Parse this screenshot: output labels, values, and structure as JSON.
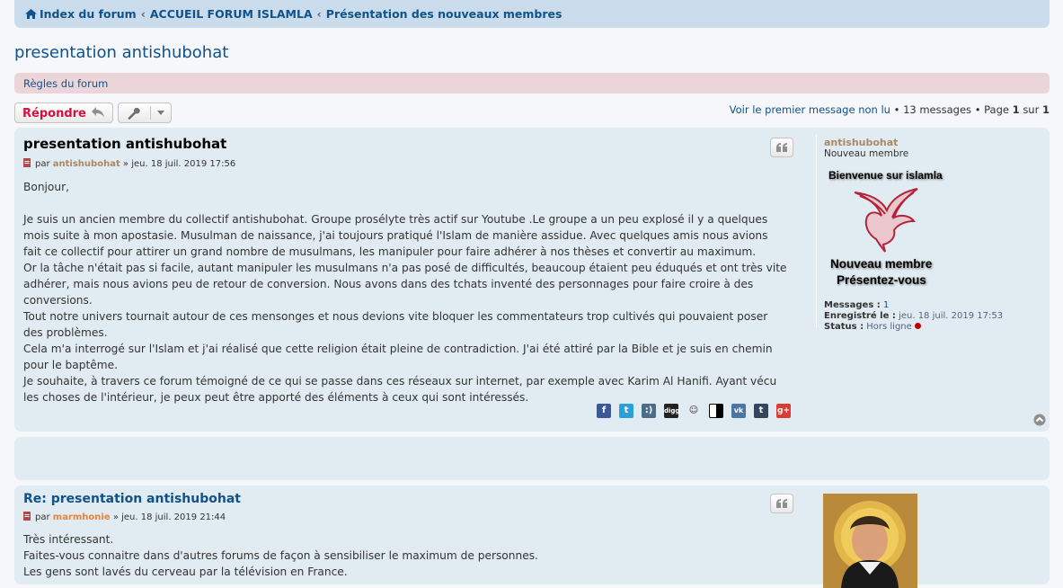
{
  "breadcrumb": {
    "home": "Index du forum",
    "items": [
      "ACCUEIL FORUM ISLAMLA",
      "Présentation des nouveaux membres"
    ],
    "separator": "‹"
  },
  "topic": {
    "title": "presentation antishubohat"
  },
  "rules": {
    "label": "Règles du forum"
  },
  "actions": {
    "reply_label": "Répondre",
    "reply_icon": "reply-icon",
    "tools_icon": "wrench-icon"
  },
  "pagination": {
    "first_unread": "Voir le premier message non lu",
    "bullet": "•",
    "messages": "13 messages",
    "page_label": "Page",
    "current": "1",
    "of": "sur",
    "total": "1"
  },
  "posts": [
    {
      "title": "presentation antishubohat",
      "by": "par",
      "author": "antishubohat",
      "sep": "»",
      "date": "jeu. 18 juil. 2019 17:56",
      "paragraphs": [
        "Bonjour,",
        "",
        "Je suis un ancien membre du collectif antishubohat. Groupe prosélyte très actif sur Youtube .Le groupe a un peu explosé il y a quelques mois suite à mon apostasie. Musulman de naissance, j'ai toujours pratiqué l'Islam de manière assidue. Avec quelques amis nous avions fait ce collectif pour attirer un grand nombre de musulmans, les manipuler pour faire adhérer à nos thèses et convertir au maximum.",
        "Or la tâche n'était pas si facile, autant manipuler les musulmans n'a pas posé de difficultés, beaucoup étaient peu éduqués et ont très vite adhérer, mais nous avions peu de retour de conversion. Nous avons dans des tchats inventé des personnages pour faire croire à des conversions.",
        "Tout notre univers tournait autour de ces mensonges et nous devions vite bloquer les commentateurs trop cultivés qui pouvaient poser des problèmes.",
        "Cela m'a interrogé sur l'Islam et j'ai réalisé que cette religion était pleine de contradiction. J'ai été attiré par la Bible et je suis en chemin pour le baptême.",
        "Je souhaite, à travers ce forum témoigné de ce qui se passe dans ces réseaux sur internet, par exemple avec Karim Al Hanifi. Ayant vécu les choses de l'intérieur, je peux peut être apporté des éléments à ceux qui sont intéressés."
      ],
      "profile": {
        "name": "antishubohat",
        "rank": "Nouveau membre",
        "rank_image_line1": "Bienvenue sur islamla",
        "rank_image_line2": "Nouveau membre",
        "rank_image_line3": "Présentez-vous",
        "messages_label": "Messages :",
        "messages_value": "1",
        "registered_label": "Enregistré le :",
        "registered_value": "jeu. 18 juil. 2019 17:53",
        "status_label": "Status :",
        "status_value": "Hors ligne"
      },
      "share_icons": [
        "facebook-icon",
        "twitter-icon",
        "tumblr-like-icon",
        "digg-icon",
        "reddit-icon",
        "delicious-icon",
        "vk-icon",
        "tumblr-icon",
        "google-plus-icon"
      ]
    },
    {
      "title": "Re: presentation antishubohat",
      "by": "par",
      "author": "marmhonie",
      "sep": "»",
      "date": "jeu. 18 juil. 2019 21:44",
      "paragraphs": [
        "Très intéressant.",
        "Faites-vous connaitre dans d'autres forums de façon à sensibiliser le maximum de personnes.",
        "Les gens sont lavés du cerveau par la télévision en France."
      ]
    }
  ],
  "colors": {
    "link": "#105289",
    "post_bg": "#e1ebf2",
    "reply": "#d31141",
    "author1": "#aa8866",
    "author2": "#e5843c",
    "rules_bg": "#ecd5d8"
  }
}
